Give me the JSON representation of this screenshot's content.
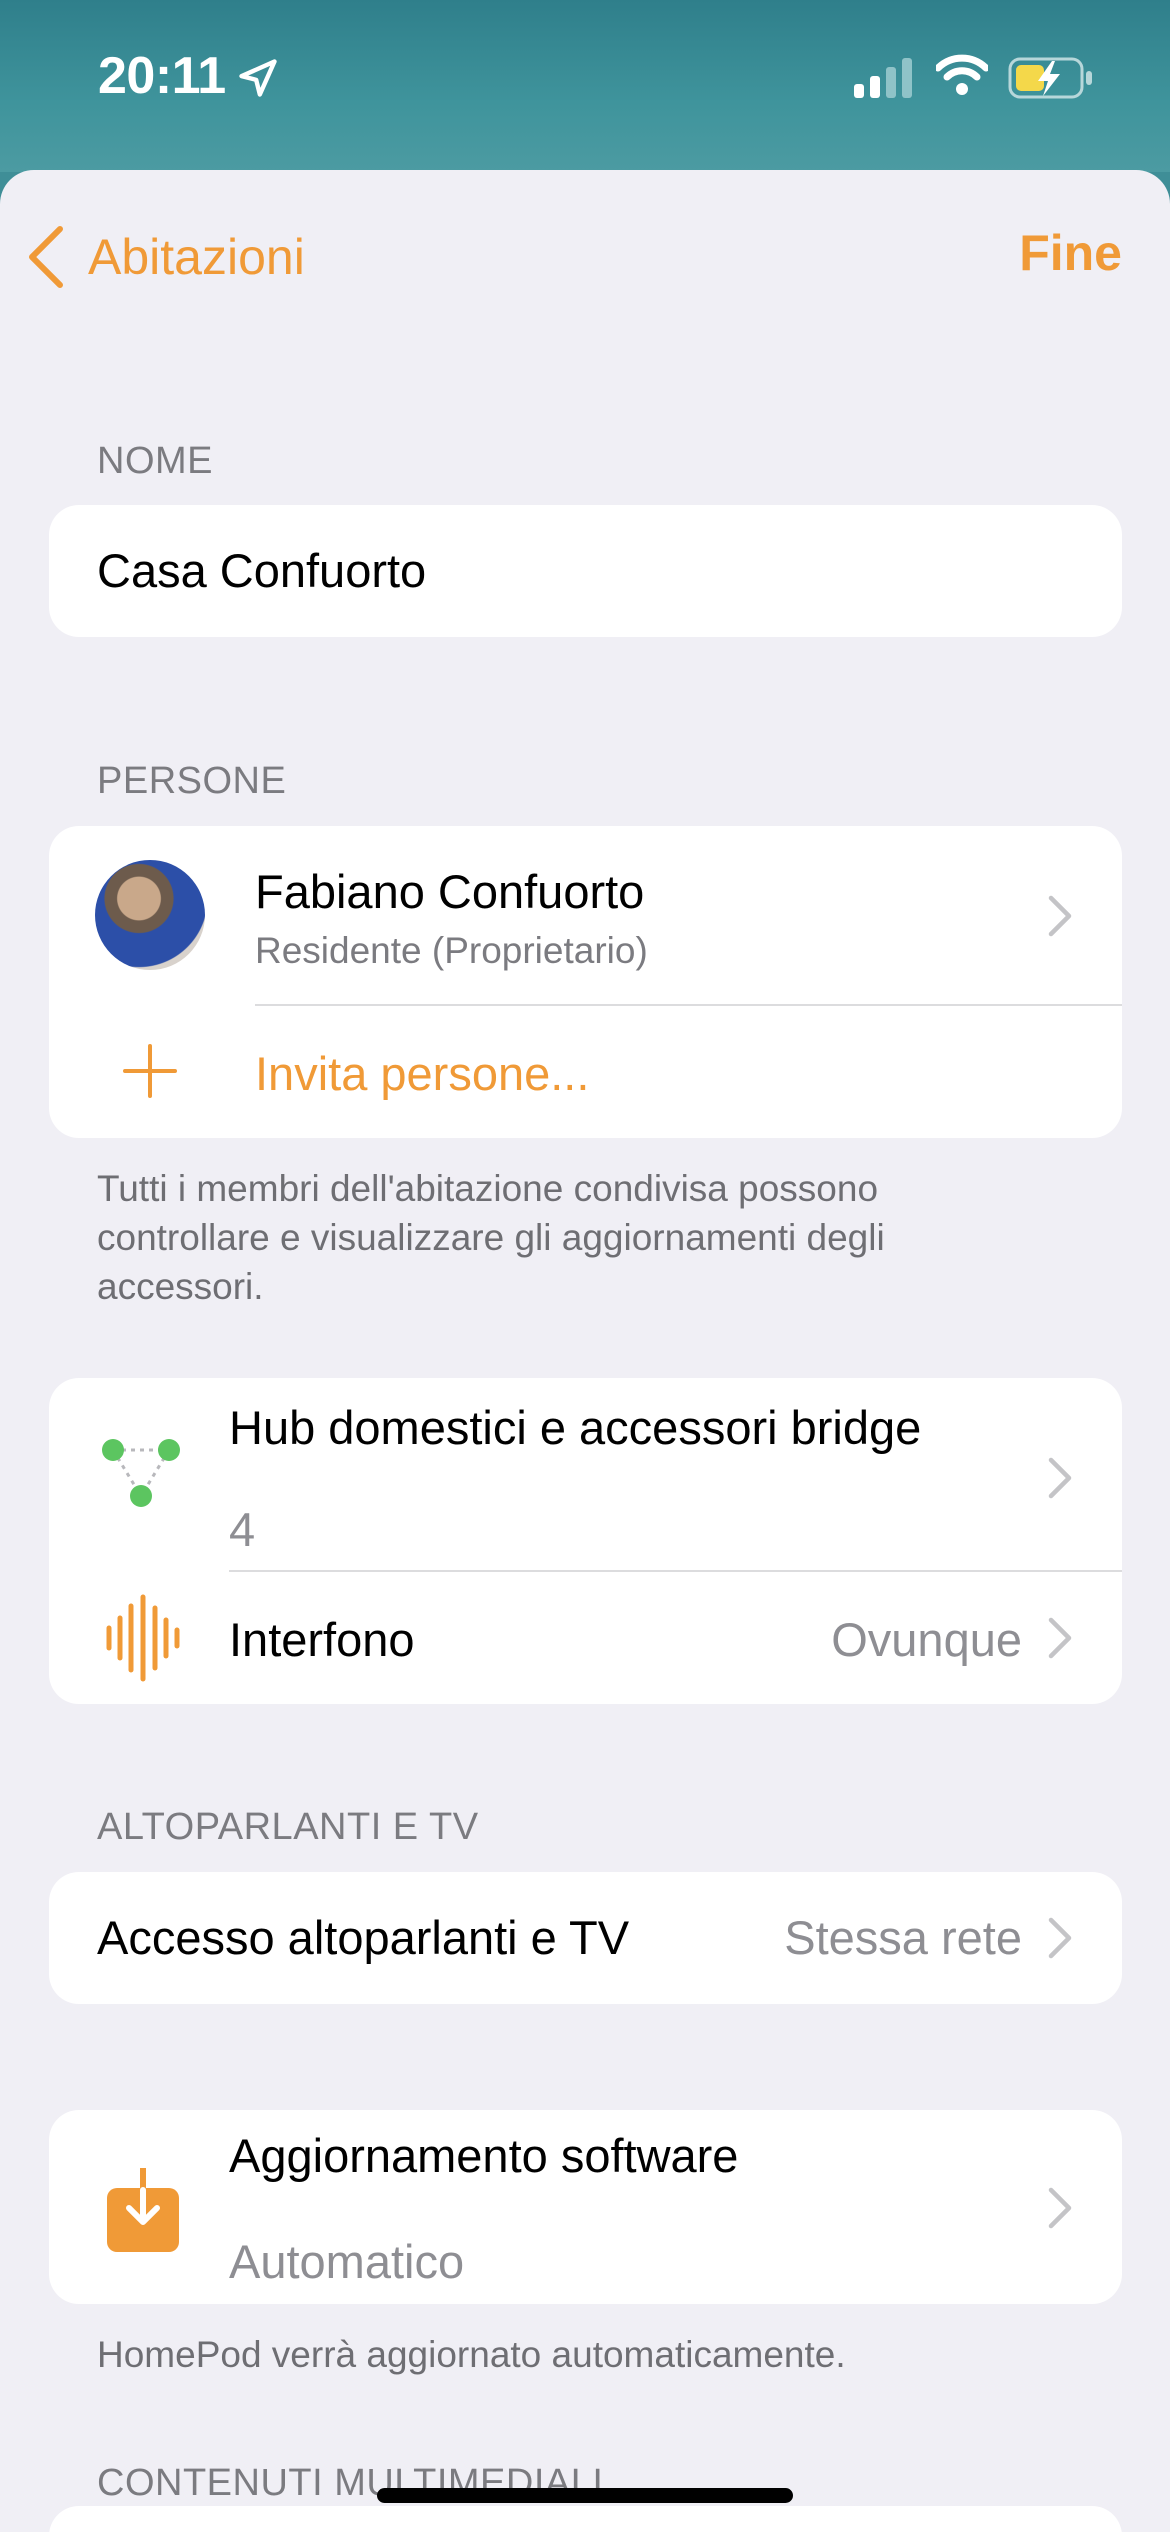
{
  "status_bar": {
    "time": "20:11"
  },
  "nav": {
    "back_label": "Abitazioni",
    "done_label": "Fine"
  },
  "name_section": {
    "header": "NOME",
    "value": "Casa Confuorto"
  },
  "people_section": {
    "header": "PERSONE",
    "person": {
      "name": "Fabiano Confuorto",
      "role": "Residente (Proprietario)"
    },
    "invite_label": "Invita persone...",
    "footnote": "Tutti i membri dell'abitazione condivisa possono controllare e visualizzare gli aggiornamenti degli accessori."
  },
  "hubs_section": {
    "hubs": {
      "title": "Hub domestici e accessori bridge",
      "count": "4"
    },
    "intercom": {
      "title": "Interfono",
      "value": "Ovunque"
    }
  },
  "speakers_section": {
    "header": "ALTOPARLANTI E TV",
    "access": {
      "title": "Accesso altoparlanti e TV",
      "value": "Stessa rete"
    }
  },
  "software_section": {
    "title": "Aggiornamento software",
    "value": "Automatico",
    "footnote": "HomePod verrà aggiornato automaticamente."
  },
  "media_section": {
    "header": "CONTENUTI MULTIMEDIALI"
  },
  "colors": {
    "accent": "#f09a37",
    "hub_green": "#5cc560",
    "background": "#f0eff5"
  }
}
